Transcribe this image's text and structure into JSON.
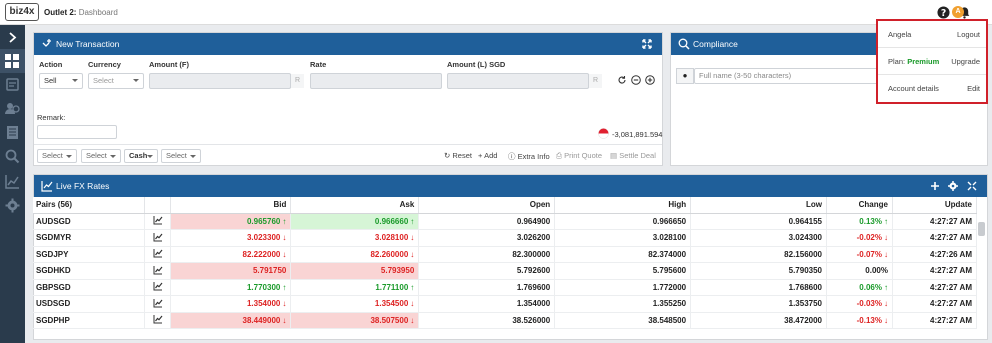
{
  "app": {
    "logo": "biz4x",
    "outlet": "Outlet 2:",
    "page": "Dashboard",
    "avatar_initial": "A"
  },
  "new_transaction": {
    "title": "New Transaction",
    "labels": {
      "action": "Action",
      "currency": "Currency",
      "amount_f": "Amount (F)",
      "rate": "Rate",
      "amount_l": "Amount (L) SGD",
      "remark": "Remark:"
    },
    "action_value": "Sell",
    "currency_placeholder": "Select",
    "amount_f_suffix": "R",
    "amount_l_suffix": "R",
    "balance": "-3,081,891.594",
    "footer_selects": [
      "Select",
      "Select",
      "Cash",
      "Select"
    ],
    "actions": {
      "reset": "Reset",
      "add": "Add",
      "extra": "Extra Info",
      "print": "Print Quote",
      "settle": "Settle Deal"
    }
  },
  "compliance": {
    "title": "Compliance",
    "name_placeholder": "Full name (3-50 characters)"
  },
  "fx": {
    "title": "Live FX Rates",
    "headers": [
      "Pairs (56)",
      "",
      "Bid",
      "Ask",
      "Open",
      "High",
      "Low",
      "Change",
      "Update"
    ],
    "rows": [
      {
        "pair": "AUDSGD",
        "bid": "0.965760",
        "bid_dir": "up",
        "bid_bg": "down",
        "ask": "0.966660",
        "ask_dir": "up",
        "ask_bg": "up",
        "open": "0.964900",
        "high": "0.966650",
        "low": "0.964155",
        "change": "0.13%",
        "change_dir": "up",
        "update": "4:27:27 AM"
      },
      {
        "pair": "SGDMYR",
        "bid": "3.023300",
        "bid_dir": "down",
        "bid_bg": "",
        "ask": "3.028100",
        "ask_dir": "down",
        "ask_bg": "",
        "open": "3.026200",
        "high": "3.028100",
        "low": "3.024300",
        "change": "-0.02%",
        "change_dir": "down",
        "update": "4:27:27 AM"
      },
      {
        "pair": "SGDJPY",
        "bid": "82.222000",
        "bid_dir": "down",
        "bid_bg": "",
        "ask": "82.260000",
        "ask_dir": "down",
        "ask_bg": "",
        "open": "82.300000",
        "high": "82.374000",
        "low": "82.156000",
        "change": "-0.07%",
        "change_dir": "down",
        "update": "4:27:26 AM"
      },
      {
        "pair": "SGDHKD",
        "bid": "5.791750",
        "bid_dir": "",
        "bid_bg": "down",
        "ask": "5.793950",
        "ask_dir": "",
        "ask_bg": "down",
        "open": "5.792600",
        "high": "5.795600",
        "low": "5.790350",
        "change": "0.00%",
        "change_dir": "",
        "update": "4:27:27 AM"
      },
      {
        "pair": "GBPSGD",
        "bid": "1.770300",
        "bid_dir": "up",
        "bid_bg": "",
        "ask": "1.771100",
        "ask_dir": "up",
        "ask_bg": "",
        "open": "1.769600",
        "high": "1.772000",
        "low": "1.768600",
        "change": "0.06%",
        "change_dir": "up",
        "update": "4:27:27 AM"
      },
      {
        "pair": "USDSGD",
        "bid": "1.354000",
        "bid_dir": "down",
        "bid_bg": "",
        "ask": "1.354500",
        "ask_dir": "down",
        "ask_bg": "",
        "open": "1.354000",
        "high": "1.355250",
        "low": "1.353750",
        "change": "-0.03%",
        "change_dir": "down",
        "update": "4:27:27 AM"
      },
      {
        "pair": "SGDPHP",
        "bid": "38.449000",
        "bid_dir": "down",
        "bid_bg": "down",
        "ask": "38.507500",
        "ask_dir": "down",
        "ask_bg": "down",
        "open": "38.526000",
        "high": "38.548500",
        "low": "38.472000",
        "change": "-0.13%",
        "change_dir": "down",
        "update": "4:27:27 AM"
      }
    ]
  },
  "user_menu": {
    "name": "Angela",
    "logout": "Logout",
    "plan_label": "Plan:",
    "plan_value": "Premium",
    "upgrade": "Upgrade",
    "account": "Account details",
    "edit": "Edit"
  },
  "colors": {
    "header_blue": "#1f5f9a",
    "sidebar": "#2a3b4c",
    "up_green": "#1a9a2a",
    "down_red": "#d22",
    "up_bg": "#d6f5d6",
    "down_bg": "#f9d4d4",
    "highlight_border": "#d0202a",
    "premium": "#1a9a2a"
  }
}
